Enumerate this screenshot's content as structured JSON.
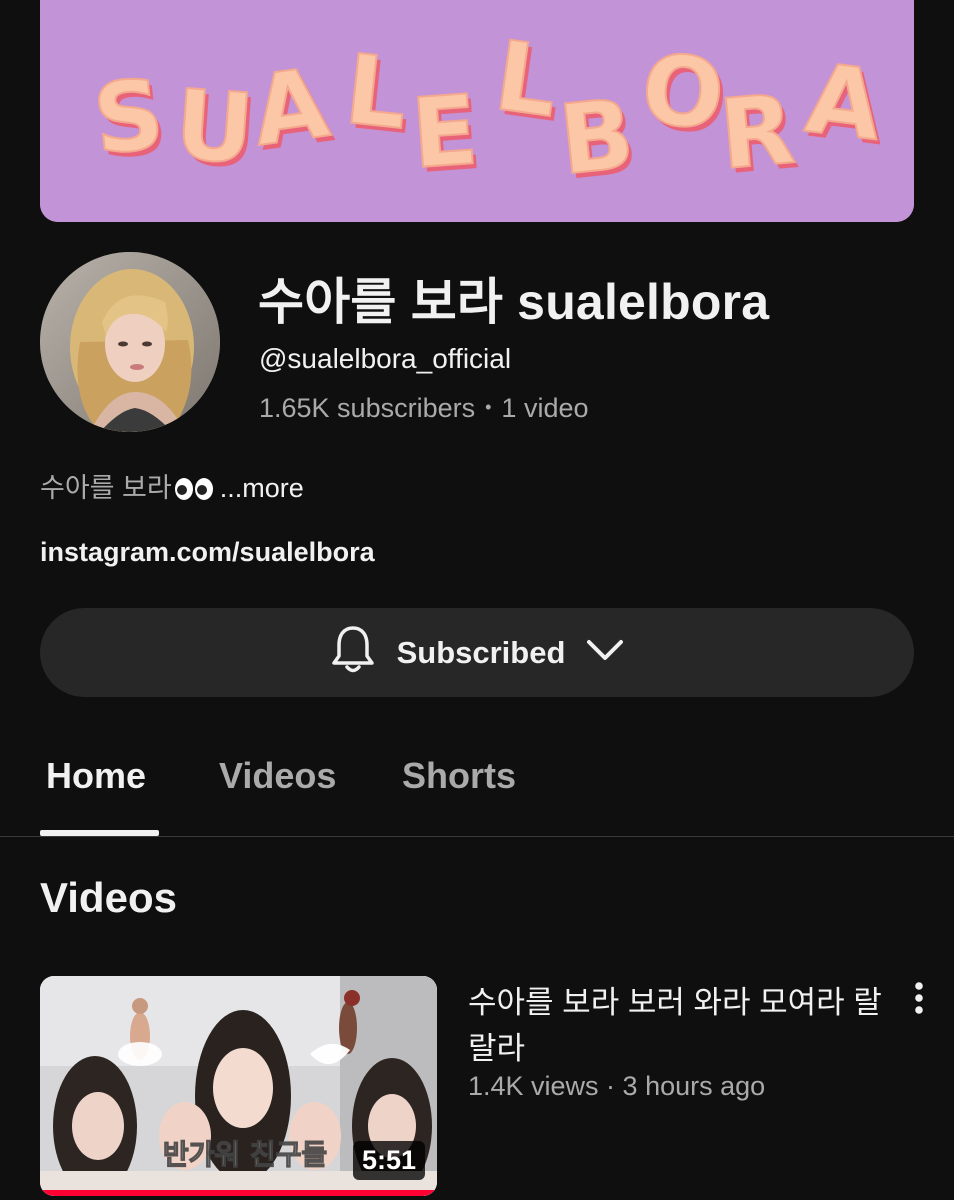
{
  "banner": {
    "text": "SUALELBORA",
    "bg_color": "#c293d6",
    "letter_color": "#fbc7a6",
    "shadow_color": "#e8627a"
  },
  "channel": {
    "name": "수아를 보라 sualelbora",
    "handle": "@sualelbora_official",
    "subscribers": "1.65K subscribers",
    "separator": "•",
    "video_count": "1 video",
    "description": "수아를 보라",
    "description_emoji": "eyes-emoji",
    "more_label": "...more",
    "link": "instagram.com/sualelbora"
  },
  "subscribe": {
    "label": "Subscribed",
    "bell_icon": "bell-icon",
    "chevron_icon": "chevron-down-icon"
  },
  "tabs": [
    {
      "label": "Home",
      "active": true
    },
    {
      "label": "Videos",
      "active": false
    },
    {
      "label": "Shorts",
      "active": false
    }
  ],
  "section": {
    "title": "Videos"
  },
  "videos": [
    {
      "title": "수아를 보라 보러 와라 모여라 랄랄라",
      "meta": "1.4K views · 3 hours ago",
      "duration": "5:51",
      "thumbnail_caption": "반가워 친구들",
      "watched_fraction": 1.0
    }
  ],
  "colors": {
    "background": "#0f0f0f",
    "button_bg": "#272727",
    "text_primary": "#f1f1f1",
    "text_secondary": "#aaaaaa",
    "progress": "#ff0033"
  }
}
